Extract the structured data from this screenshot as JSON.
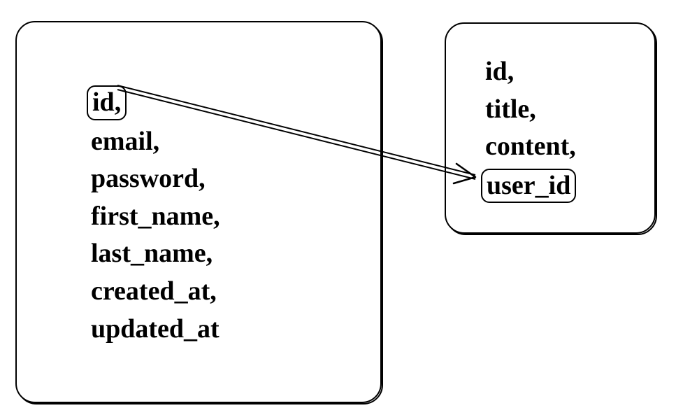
{
  "tables": {
    "left": {
      "fields": [
        {
          "label": "id,",
          "highlighted": true
        },
        {
          "label": "email,",
          "highlighted": false
        },
        {
          "label": "password,",
          "highlighted": false
        },
        {
          "label": "first_name,",
          "highlighted": false
        },
        {
          "label": "last_name,",
          "highlighted": false
        },
        {
          "label": "created_at,",
          "highlighted": false
        },
        {
          "label": "updated_at",
          "highlighted": false
        }
      ]
    },
    "right": {
      "fields": [
        {
          "label": "id,",
          "highlighted": false
        },
        {
          "label": "title,",
          "highlighted": false
        },
        {
          "label": "content,",
          "highlighted": false
        },
        {
          "label": "user_id",
          "highlighted": true
        }
      ]
    }
  },
  "relationship": {
    "from": "left.id",
    "to": "right.user_id"
  }
}
